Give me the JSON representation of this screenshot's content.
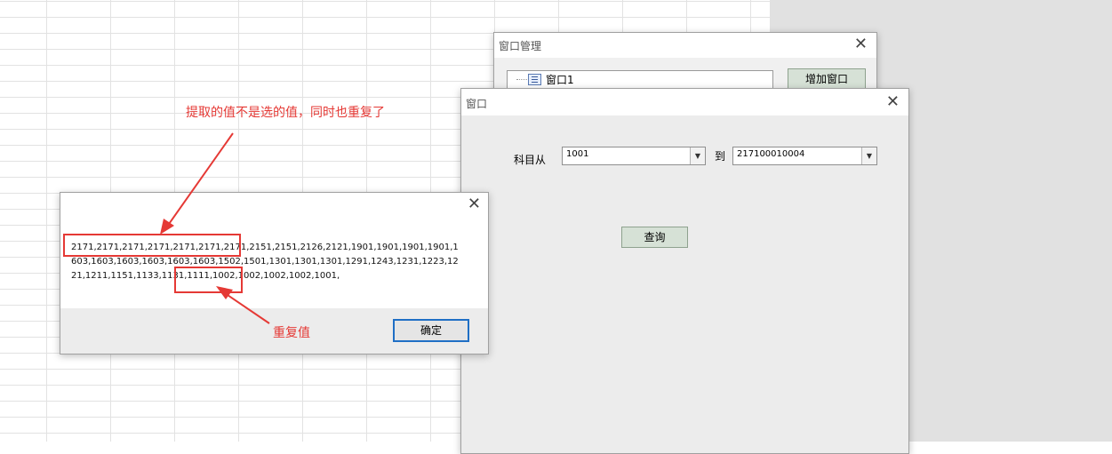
{
  "window_manager": {
    "title": "窗口管理",
    "tree_item": "窗口1",
    "add_window_button": "增加窗口"
  },
  "query_window": {
    "title": "窗口",
    "subject_from_label": "科目从",
    "from_value": "1001",
    "to_label": "到",
    "to_value": "217100010004",
    "query_button": "查询"
  },
  "message_box": {
    "text": "2171,2171,2171,2171,2171,2171,2171,2151,2151,2126,2121,1901,1901,1901,1901,1603,1603,1603,1603,1603,1603,1502,1501,1301,1301,1301,1291,1243,1231,1223,1221,1211,1151,1133,1131,1111,1002,1002,1002,1002,1001,",
    "ok_button": "确定"
  },
  "annotations": {
    "top_note": "提取的值不是选的值，同时也重复了",
    "duplicate_note": "重复值",
    "color": "#e53935"
  },
  "icons": [
    "close-icon",
    "dropdown-arrow-icon",
    "window-tree-icon"
  ]
}
